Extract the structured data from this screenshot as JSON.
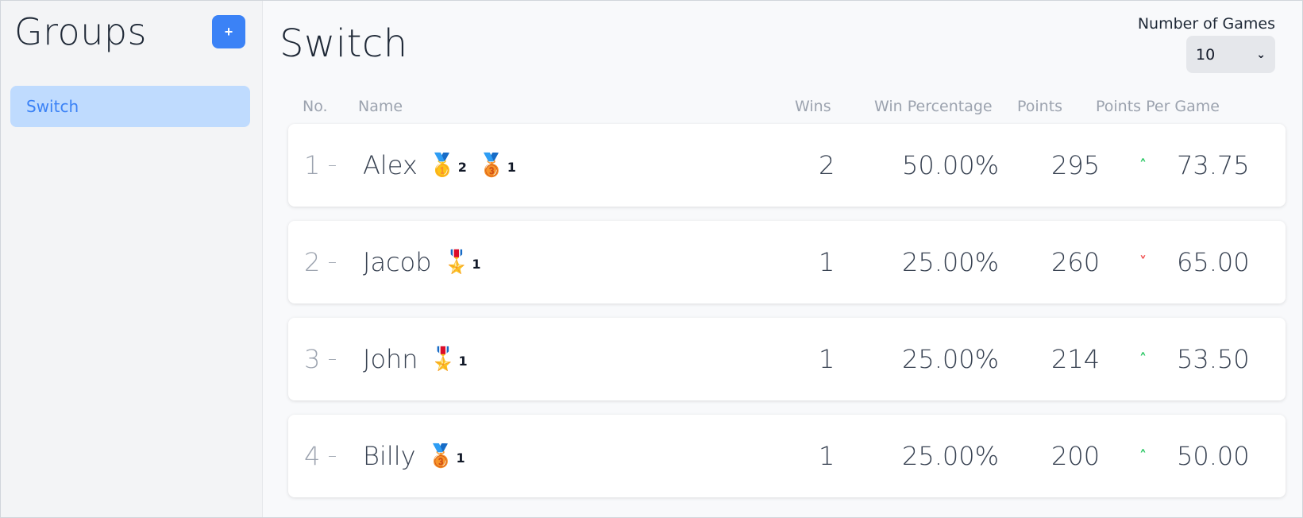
{
  "sidebar": {
    "title": "Groups",
    "add_label": "+",
    "items": [
      {
        "label": "Switch"
      }
    ]
  },
  "main": {
    "title": "Switch",
    "games_label": "Number of Games",
    "games_selected": "10"
  },
  "table": {
    "headers": {
      "no": "No.",
      "name": "Name",
      "wins": "Wins",
      "win_pct": "Win Percentage",
      "points": "Points",
      "ppg": "Points Per Game"
    },
    "rows": [
      {
        "rank": "1",
        "rank_change": "–",
        "name": "Alex",
        "medals": [
          {
            "icon": "gold-medal-icon",
            "glyph": "🥇",
            "count": "2"
          },
          {
            "icon": "bronze-medal-icon",
            "glyph": "🥉",
            "count": "1"
          }
        ],
        "wins": "2",
        "win_pct": "50.00%",
        "points": "295",
        "trend": "up",
        "ppg": "73.75"
      },
      {
        "rank": "2",
        "rank_change": "–",
        "name": "Jacob",
        "medals": [
          {
            "icon": "military-medal-icon",
            "glyph": "🎖️",
            "count": "1"
          }
        ],
        "wins": "1",
        "win_pct": "25.00%",
        "points": "260",
        "trend": "down",
        "ppg": "65.00"
      },
      {
        "rank": "3",
        "rank_change": "–",
        "name": "John",
        "medals": [
          {
            "icon": "military-medal-icon",
            "glyph": "🎖️",
            "count": "1"
          }
        ],
        "wins": "1",
        "win_pct": "25.00%",
        "points": "214",
        "trend": "up",
        "ppg": "53.50"
      },
      {
        "rank": "4",
        "rank_change": "–",
        "name": "Billy",
        "medals": [
          {
            "icon": "bronze-medal-icon",
            "glyph": "🥉",
            "count": "1"
          }
        ],
        "wins": "1",
        "win_pct": "25.00%",
        "points": "200",
        "trend": "up",
        "ppg": "50.00"
      }
    ]
  },
  "colors": {
    "accent": "#3b82f6",
    "selected_bg": "#bfdbfe",
    "trend_up": "#22c55e",
    "trend_down": "#ef4444"
  }
}
